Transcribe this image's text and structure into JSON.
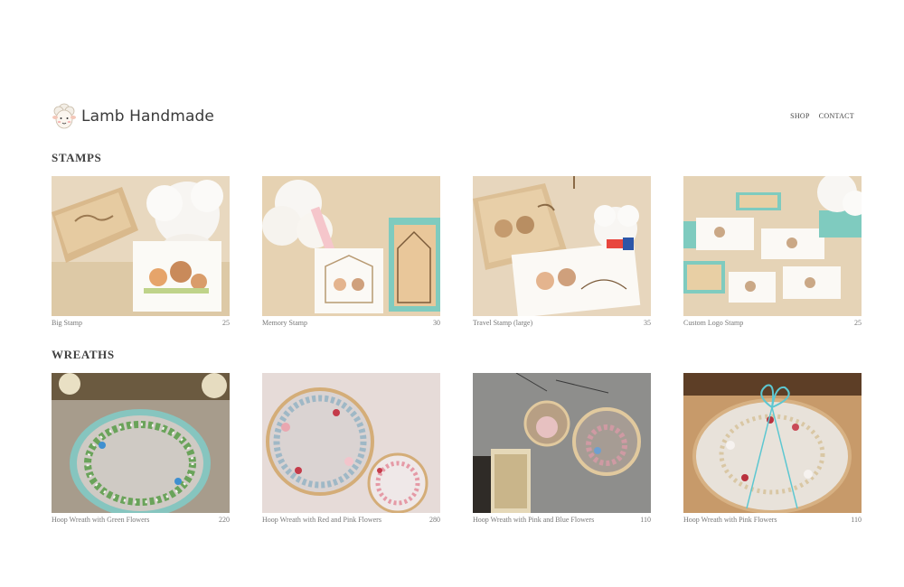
{
  "brand": {
    "name": "Lamb Handmade",
    "logo_icon": "lamb-face-icon"
  },
  "nav": {
    "items": [
      "SHOP",
      "CONTACT"
    ]
  },
  "sections": [
    {
      "title": "STAMPS",
      "products": [
        {
          "name": "Big Stamp",
          "price": "25"
        },
        {
          "name": "Memory Stamp",
          "price": "30"
        },
        {
          "name": "Travel Stamp (large)",
          "price": "35"
        },
        {
          "name": "Custom Logo Stamp",
          "price": "25"
        }
      ]
    },
    {
      "title": "WREATHS",
      "products": [
        {
          "name": "Hoop Wreath with Green Flowers",
          "price": "220"
        },
        {
          "name": "Hoop Wreath with Red and Pink Flowers",
          "price": "280"
        },
        {
          "name": "Hoop Wreath with Pink and Blue Flowers",
          "price": "110"
        },
        {
          "name": "Hoop Wreath with Pink Flowers",
          "price": "110"
        }
      ]
    }
  ]
}
